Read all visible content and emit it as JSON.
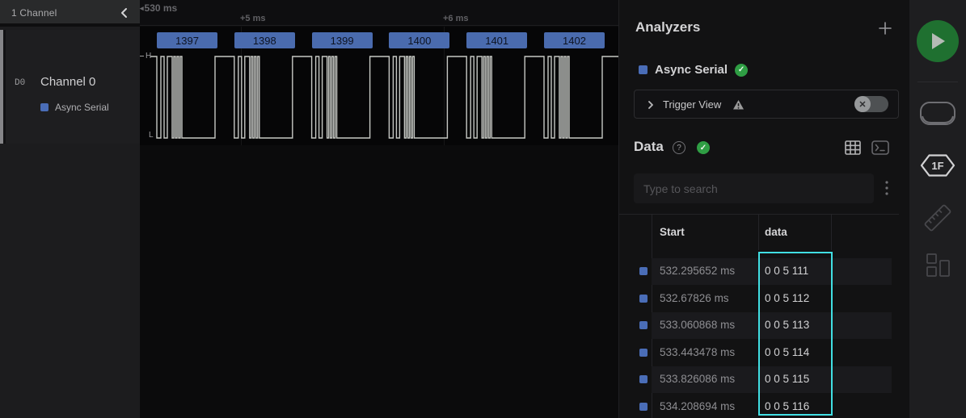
{
  "colors": {
    "accent_blue": "#4a6db7",
    "frame_blue": "#4a6bae",
    "highlight_cyan": "#41dfe3",
    "status_green": "#2f9e44",
    "play_green": "#1f7030"
  },
  "sidebar_left": {
    "header_title": "1 Channel",
    "collapse_icon": "chevron-left",
    "channel": {
      "id": "D0",
      "name": "Channel 0",
      "analyzer_label": "Async Serial"
    }
  },
  "timeline": {
    "anchor_label": "530 ms",
    "markers": [
      {
        "label": "+5 ms"
      },
      {
        "label": "+6 ms"
      }
    ],
    "high_label": "H",
    "low_label": "L"
  },
  "frames": [
    "1397",
    "1398",
    "1399",
    "1400",
    "1401",
    "1402"
  ],
  "analyzers_panel": {
    "title": "Analyzers",
    "add_icon": "plus",
    "analyzer": {
      "name": "Async Serial",
      "status_icon": "check-circle"
    },
    "trigger": {
      "label": "Trigger View",
      "warning_icon": "warning-triangle",
      "toggle_state": "off"
    },
    "data_section": {
      "title": "Data",
      "help_icon": "?",
      "status_icon": "check-circle",
      "table_view_icon": "grid",
      "terminal_view_icon": "terminal"
    },
    "search": {
      "placeholder": "Type to search",
      "menu_icon": "kebab"
    },
    "table": {
      "columns": [
        "Start",
        "data"
      ],
      "rows": [
        {
          "start": "532.295652 ms",
          "data": "0 0 5 111"
        },
        {
          "start": "532.67826 ms",
          "data": "0 0 5 112"
        },
        {
          "start": "533.060868 ms",
          "data": "0 0 5 113"
        },
        {
          "start": "533.443478 ms",
          "data": "0 0 5 114"
        },
        {
          "start": "533.826086 ms",
          "data": "0 0 5 115"
        },
        {
          "start": "534.208694 ms",
          "data": "0 0 5 116"
        }
      ]
    }
  },
  "right_toolbar": {
    "play_icon": "play",
    "device_icon": "device",
    "hex_display_label": "1F",
    "measure_icon": "ruler",
    "layout_icon": "layout-grid"
  }
}
